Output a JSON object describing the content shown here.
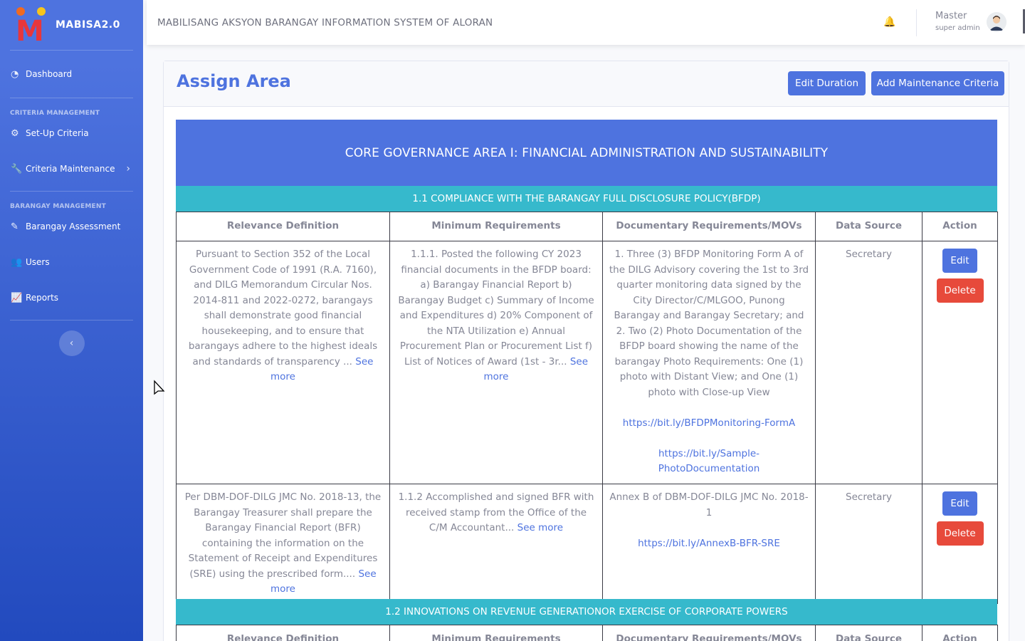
{
  "sidebar": {
    "brand": "MABISA2.0",
    "items": [
      {
        "label": "Dashboard",
        "icon": "dashboard-icon"
      },
      {
        "label": "Set-Up Criteria",
        "icon": "gear-icon"
      },
      {
        "label": "Criteria Maintenance",
        "icon": "wrench-icon"
      },
      {
        "label": "Barangay Assessment",
        "icon": "edit-icon"
      },
      {
        "label": "Users",
        "icon": "users-icon"
      },
      {
        "label": "Reports",
        "icon": "chart-line-icon"
      }
    ],
    "headings": [
      "CRITERIA MANAGEMENT",
      "BARANGAY MANAGEMENT"
    ]
  },
  "topbar": {
    "title": "MABILISANG AKSYON BARANGAY INFORMATION SYSTEM OF ALORAN",
    "user_name": "Master",
    "user_role": "super admin"
  },
  "page": {
    "title": "Assign Area",
    "edit_duration_label": "Edit Duration",
    "add_maintenance_label": "Add Maintenance Criteria",
    "area_title": "CORE GOVERNANCE AREA I: FINANCIAL ADMINISTRATION AND SUSTAINABILITY"
  },
  "sections": [
    {
      "title": "1.1 COMPLIANCE WITH THE BARANGAY FULL DISCLOSURE POLICY(BFDP)",
      "rows": [
        {
          "relevance": "Pursuant to Section 352 of the Local Government Code of 1991 (R.A. 7160), and DILG Memorandum Circular Nos. 2014-811 and 2022-0272, barangays shall demonstrate good financial housekeeping, and to ensure that barangays adhere to the highest ideals and standards of transparency ...",
          "minimum": "1.1.1. Posted the following CY 2023 financial documents in the BFDP board: a) Barangay Financial Report b) Barangay Budget c) Summary of Income and Expenditures d) 20% Component of the NTA Utilization e) Annual Procurement Plan or Procurement List f) List of Notices of Award (1st - 3r...",
          "documentary": "1. Three (3) BFDP Monitoring Form A of the DILG Advisory covering the 1st to 3rd quarter monitoring data signed by the City Director/C/MLGOO, Punong Barangay and Barangay Secretary; and 2. Two (2) Photo Documentation of the BFDP board showing the name of the barangay Photo Requirements: One (1) photo with Distant View; and One (1) photo with Close-up View",
          "links": [
            "https://bit.ly/BFDPMonitoring-FormA",
            "https://bit.ly/Sample-PhotoDocumentation"
          ],
          "source": "Secretary"
        },
        {
          "relevance": "Per DBM-DOF-DILG JMC No. 2018-13, the Barangay Treasurer shall prepare the Barangay Financial Report (BFR) containing the information on the Statement of Receipt and Expenditures (SRE) using the prescribed form....",
          "minimum": "1.1.2 Accomplished and signed BFR with received stamp from the Office of the C/M Accountant...",
          "documentary": "Annex B of DBM-DOF-DILG JMC No. 2018-1",
          "links": [
            "https://bit.ly/AnnexB-BFR-SRE"
          ],
          "source": "Secretary"
        }
      ]
    },
    {
      "title": "1.2 INNOVATIONS ON REVENUE GENERATIONOR EXERCISE OF CORPORATE POWERS",
      "rows": []
    }
  ],
  "table": {
    "headers": [
      "Relevance Definition",
      "Minimum Requirements",
      "Documentary Requirements/MOVs",
      "Data Source",
      "Action"
    ],
    "see_more": "See more",
    "edit_label": "Edit",
    "delete_label": "Delete"
  }
}
